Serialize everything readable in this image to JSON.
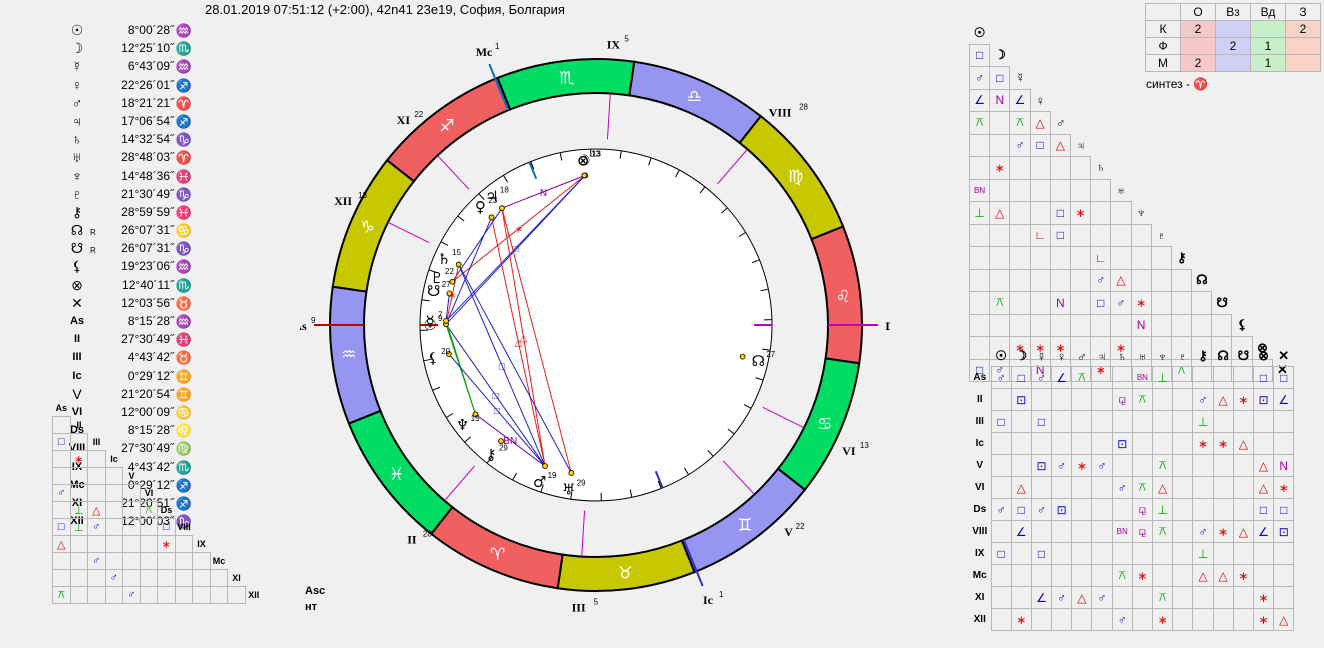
{
  "header": "28.01.2019 07:51:12 (+2:00), 42n41 23e19, София, Болгария",
  "planets": [
    {
      "glyph": "☉",
      "r": "",
      "deg": "8°00´28˝",
      "sign": "♒"
    },
    {
      "glyph": "☽",
      "r": "",
      "deg": "12°25´10˝",
      "sign": "♏"
    },
    {
      "glyph": "☿",
      "r": "",
      "deg": "6°43´09˝",
      "sign": "♒"
    },
    {
      "glyph": "♀",
      "r": "",
      "deg": "22°26´01˝",
      "sign": "♐"
    },
    {
      "glyph": "♂",
      "r": "",
      "deg": "18°21´21˝",
      "sign": "♈"
    },
    {
      "glyph": "♃",
      "r": "",
      "deg": "17°06´54˝",
      "sign": "♐"
    },
    {
      "glyph": "♄",
      "r": "",
      "deg": "14°32´54˝",
      "sign": "♑"
    },
    {
      "glyph": "♅",
      "r": "",
      "deg": "28°48´03˝",
      "sign": "♈"
    },
    {
      "glyph": "♆",
      "r": "",
      "deg": "14°48´36˝",
      "sign": "♓"
    },
    {
      "glyph": "♇",
      "r": "",
      "deg": "21°30´49˝",
      "sign": "♑"
    },
    {
      "glyph": "⚷",
      "r": "",
      "deg": "28°59´59˝",
      "sign": "♓"
    },
    {
      "glyph": "☊",
      "r": "R",
      "deg": "26°07´31˝",
      "sign": "♋"
    },
    {
      "glyph": "☋",
      "r": "R",
      "deg": "26°07´31˝",
      "sign": "♑"
    },
    {
      "glyph": "⚸",
      "r": "",
      "deg": "19°23´06˝",
      "sign": "♒"
    },
    {
      "glyph": "⊗",
      "r": "",
      "deg": "12°40´11˝",
      "sign": "♏"
    },
    {
      "glyph": "✕",
      "r": "",
      "deg": "12°03´56˝",
      "sign": "♉"
    },
    {
      "glyph": "As",
      "r": "",
      "deg": "8°15´28˝",
      "sign": "♒"
    },
    {
      "glyph": "II",
      "r": "",
      "deg": "27°30´49˝",
      "sign": "♓"
    },
    {
      "glyph": "III",
      "r": "",
      "deg": "4°43´42˝",
      "sign": "♉"
    },
    {
      "glyph": "Ic",
      "r": "",
      "deg": "0°29´12˝",
      "sign": "♊"
    },
    {
      "glyph": "V",
      "r": "",
      "deg": "21°20´54˝",
      "sign": "♊"
    },
    {
      "glyph": "VI",
      "r": "",
      "deg": "12°00´09˝",
      "sign": "♋"
    },
    {
      "glyph": "Ds",
      "r": "",
      "deg": "8°15´28˝",
      "sign": "♌"
    },
    {
      "glyph": "VIII",
      "r": "",
      "deg": "27°30´49˝",
      "sign": "♍"
    },
    {
      "glyph": "IX",
      "r": "",
      "deg": "4°43´42˝",
      "sign": "♏"
    },
    {
      "glyph": "Mc",
      "r": "",
      "deg": "0°29´12˝",
      "sign": "♐"
    },
    {
      "glyph": "XI",
      "r": "",
      "deg": "21°20´51˝",
      "sign": "♐"
    },
    {
      "glyph": "XII",
      "r": "",
      "deg": "12°00´03˝",
      "sign": "♑"
    }
  ],
  "elements": {
    "cols": [
      "О",
      "Вз",
      "Вд",
      "З"
    ],
    "rows": [
      {
        "label": "К",
        "vals": [
          "2",
          "",
          "",
          "2"
        ]
      },
      {
        "label": "Ф",
        "vals": [
          "",
          "2",
          "1",
          ""
        ]
      },
      {
        "label": "М",
        "vals": [
          "2",
          "",
          "1",
          ""
        ]
      }
    ],
    "colors": [
      "#f6c8c8",
      "#d0d0f6",
      "#c8f0c8",
      "#f8d2c4"
    ]
  },
  "synthesis": "синтез - ♈",
  "asc_label": "Asc",
  "nt_label": "нт",
  "tri_labels": [
    "☉",
    "☽",
    "☿",
    "♀",
    "♂",
    "♃",
    "♄",
    "♅",
    "♆",
    "♇",
    "⚷",
    "☊",
    "☋",
    "⚸",
    "⊗",
    "✕"
  ],
  "tri_cells": [
    [
      "□"
    ],
    [
      "♂",
      "□"
    ],
    [
      "∠",
      "N",
      "∠"
    ],
    [
      "⚻",
      "",
      "⚻",
      "△"
    ],
    [
      "",
      "",
      "♂",
      "□",
      "△"
    ],
    [
      "",
      "∗",
      "",
      "",
      "",
      ""
    ],
    [
      "BN",
      "",
      "",
      "",
      "",
      "",
      ""
    ],
    [
      "⊥",
      "△",
      "",
      "",
      "□",
      "∗",
      ""
    ],
    [
      "",
      "",
      "",
      "∟",
      "□",
      "",
      "",
      ""
    ],
    [
      "",
      "",
      "",
      "",
      "",
      "",
      "∟",
      ""
    ],
    [
      "",
      "",
      "",
      "",
      "",
      "",
      "♂",
      "△"
    ],
    [
      "",
      "⚻",
      "",
      "",
      "N",
      "",
      "□",
      "♂",
      "∗"
    ],
    [
      "",
      "",
      "",
      "",
      "",
      "",
      "",
      "",
      "N",
      ""
    ],
    [
      "",
      "",
      "∗",
      "∗",
      "∗",
      "",
      "",
      "∗",
      "",
      "",
      ""
    ],
    [
      "□",
      "♂",
      "",
      "N",
      "",
      "",
      "∗",
      "",
      "",
      "",
      "⚻",
      ""
    ],
    [
      "□",
      "♂",
      "",
      "",
      "⊥",
      "△",
      "",
      "∗",
      "",
      "",
      "",
      "",
      "♂"
    ]
  ],
  "house_header": [
    "☉",
    "☽",
    "☿",
    "♀",
    "♂",
    "♃",
    "♄",
    "♅",
    "♆",
    "♇",
    "⚷",
    "☊",
    "☋",
    "⊗",
    "✕"
  ],
  "house_rows": [
    {
      "label": "As",
      "cells": [
        "♂",
        "□",
        "♂",
        "∠",
        "⚻",
        "",
        "",
        "BN",
        "⊥",
        "",
        "",
        "",
        "",
        "□",
        "□"
      ]
    },
    {
      "label": "II",
      "cells": [
        "",
        "⊡",
        "",
        "",
        "",
        "",
        "⚼",
        "⚻",
        "",
        "",
        "♂",
        "△",
        "∗",
        "⊡",
        "∠"
      ]
    },
    {
      "label": "III",
      "cells": [
        "□",
        "",
        "□",
        "",
        "",
        "",
        "",
        "",
        "",
        "",
        "⊥",
        "",
        "",
        "",
        ""
      ]
    },
    {
      "label": "Ic",
      "cells": [
        "",
        "",
        "",
        "",
        "",
        "",
        "⊡",
        "",
        "",
        "",
        "∗",
        "∗",
        "△",
        "",
        ""
      ]
    },
    {
      "label": "V",
      "cells": [
        "",
        "",
        "⊡",
        "♂",
        "∗",
        "♂",
        "",
        "",
        "⚻",
        "",
        "",
        "",
        "",
        "△",
        "N"
      ]
    },
    {
      "label": "VI",
      "cells": [
        "",
        "△",
        "",
        "",
        "",
        "",
        "♂",
        "⚻",
        "△",
        "",
        "",
        "",
        "",
        "△",
        "∗"
      ]
    },
    {
      "label": "Ds",
      "cells": [
        "♂",
        "□",
        "♂",
        "⊡",
        "",
        "",
        "",
        "⚼",
        "⊥",
        "",
        "",
        "",
        "",
        "□",
        "□"
      ]
    },
    {
      "label": "VIII",
      "cells": [
        "",
        "∠",
        "",
        "",
        "",
        "",
        "BN",
        "⚼",
        "⚻",
        "",
        "♂",
        "∗",
        "△",
        "∠",
        "⊡"
      ]
    },
    {
      "label": "IX",
      "cells": [
        "□",
        "",
        "□",
        "",
        "",
        "",
        "",
        "",
        "",
        "",
        "⊥",
        "",
        "",
        "",
        ""
      ]
    },
    {
      "label": "Mc",
      "cells": [
        "",
        "",
        "",
        "",
        "",
        "",
        "⚻",
        "∗",
        "",
        "",
        "△",
        "△",
        "∗",
        "",
        ""
      ]
    },
    {
      "label": "XI",
      "cells": [
        "",
        "",
        "∠",
        "♂",
        "△",
        "♂",
        "",
        "",
        "⚻",
        "",
        "",
        "",
        "",
        "∗",
        ""
      ]
    },
    {
      "label": "XII",
      "cells": [
        "",
        "∗",
        "",
        "",
        "",
        "",
        "♂",
        "",
        "∗",
        "",
        "",
        "",
        "",
        "∗",
        "△"
      ]
    }
  ],
  "small_grid_labels": [
    "As",
    "II",
    "III",
    "Ic",
    "V",
    "VI",
    "Ds",
    "VIII",
    "IX",
    "Mc",
    "XI",
    "XII"
  ],
  "small_grid_cells": [
    [
      ""
    ],
    [
      "□",
      ""
    ],
    [
      "",
      "∗",
      ""
    ],
    [
      "",
      "",
      "",
      ""
    ],
    [
      "♂",
      "",
      "",
      "",
      ""
    ],
    [
      "",
      "⊥",
      "△",
      "",
      "",
      "⚻"
    ],
    [
      "□",
      "⊥",
      "♂",
      "",
      "",
      "",
      "□"
    ],
    [
      "△",
      "",
      "",
      "",
      "",
      "",
      "∗",
      ""
    ],
    [
      "",
      "",
      "♂",
      "",
      "",
      "",
      "",
      "",
      ""
    ],
    [
      "",
      "",
      "",
      "♂",
      "",
      "",
      "",
      "",
      "",
      ""
    ],
    [
      "⚻",
      "",
      "",
      "",
      "♂",
      "",
      "",
      "",
      "",
      "",
      ""
    ]
  ],
  "wheel": {
    "signs": [
      "♈",
      "♉",
      "♊",
      "♋",
      "♌",
      "♍",
      "♎",
      "♏",
      "♐",
      "♑",
      "♒",
      "♓"
    ],
    "sign_colors": [
      "#f06060",
      "#c8c800",
      "#9696f0",
      "#00dc64",
      "#f06060",
      "#c8c800",
      "#9696f0",
      "#00dc64",
      "#f06060",
      "#c8c800",
      "#9696f0",
      "#00dc64"
    ],
    "asc_lon": 308.26,
    "cusps": [
      {
        "label": "As",
        "sup": "9",
        "lon": 308.26
      },
      {
        "label": "II",
        "sup": "28",
        "lon": 357.51
      },
      {
        "label": "III",
        "sup": "5",
        "lon": 34.73
      },
      {
        "label": "Ic",
        "sup": "1",
        "lon": 60.49
      },
      {
        "label": "V",
        "sup": "22",
        "lon": 81.35
      },
      {
        "label": "VI",
        "sup": "13",
        "lon": 102.0
      },
      {
        "label": "Ds",
        "sup": "9",
        "lon": 128.26
      },
      {
        "label": "VIII",
        "sup": "28",
        "lon": 177.51
      },
      {
        "label": "IX",
        "sup": "5",
        "lon": 214.73
      },
      {
        "label": "Mc",
        "sup": "1",
        "lon": 240.49
      },
      {
        "label": "XI",
        "sup": "22",
        "lon": 261.35
      },
      {
        "label": "XII",
        "sup": "13",
        "lon": 282.0
      }
    ],
    "bodies": [
      {
        "glyph": "☉",
        "sup": "9",
        "lon": 308.0
      },
      {
        "glyph": "☽",
        "sup": "13",
        "lon": 222.4
      },
      {
        "glyph": "☿",
        "sup": "7",
        "lon": 306.7
      },
      {
        "glyph": "♀",
        "sup": "23",
        "lon": 262.4
      },
      {
        "glyph": "♂",
        "sup": "19",
        "lon": 18.4
      },
      {
        "glyph": "♃",
        "sup": "18",
        "lon": 257.1
      },
      {
        "glyph": "♄",
        "sup": "15",
        "lon": 284.5
      },
      {
        "glyph": "♅",
        "sup": "29",
        "lon": 28.8
      },
      {
        "glyph": "♆",
        "sup": "15",
        "lon": 344.8
      },
      {
        "glyph": "♇",
        "sup": "22",
        "lon": 291.5
      },
      {
        "glyph": "⚷",
        "sup": "29",
        "lon": 359.0
      },
      {
        "glyph": "☊",
        "sup": "27",
        "lon": 116.1
      },
      {
        "glyph": "☋",
        "sup": "27",
        "lon": 296.1
      },
      {
        "glyph": "⚸",
        "sup": "20",
        "lon": 319.4
      },
      {
        "glyph": "⊗",
        "sup": "13",
        "lon": 222.7
      }
    ],
    "aspects": [
      {
        "a": 1,
        "b": 5,
        "color": "#7a00a0",
        "mark": "N"
      },
      {
        "a": 1,
        "b": 9,
        "color": "#e02020",
        "mark": "∗"
      },
      {
        "a": 1,
        "b": 2,
        "color": "#2020c0",
        "mark": "□"
      },
      {
        "a": 1,
        "b": 0,
        "color": "#2020c0",
        "mark": ""
      },
      {
        "a": 3,
        "b": 4,
        "color": "#e02020",
        "mark": "△"
      },
      {
        "a": 5,
        "b": 4,
        "color": "#e02020",
        "mark": "△"
      },
      {
        "a": 5,
        "b": 7,
        "color": "#e02020",
        "mark": ""
      },
      {
        "a": 3,
        "b": 0,
        "color": "#2020c0",
        "mark": ""
      },
      {
        "a": 5,
        "b": 9,
        "color": "#2020c0",
        "mark": ""
      },
      {
        "a": 6,
        "b": 4,
        "color": "#2020c0",
        "mark": "□"
      },
      {
        "a": 6,
        "b": 7,
        "color": "#2020c0",
        "mark": ""
      },
      {
        "a": 0,
        "b": 4,
        "color": "#2020c0",
        "mark": "□"
      },
      {
        "a": 2,
        "b": 8,
        "color": "#00a000",
        "mark": ""
      },
      {
        "a": 0,
        "b": 8,
        "color": "#00a000",
        "mark": ""
      },
      {
        "a": 13,
        "b": 4,
        "color": "#2020c0",
        "mark": "□"
      },
      {
        "a": 0,
        "b": 6,
        "color": "#e02020",
        "mark": "∗"
      },
      {
        "a": 8,
        "b": 4,
        "color": "#7a00a0",
        "mark": "BN"
      },
      {
        "a": 2,
        "b": 12,
        "color": "#2020c0",
        "mark": ""
      }
    ]
  }
}
